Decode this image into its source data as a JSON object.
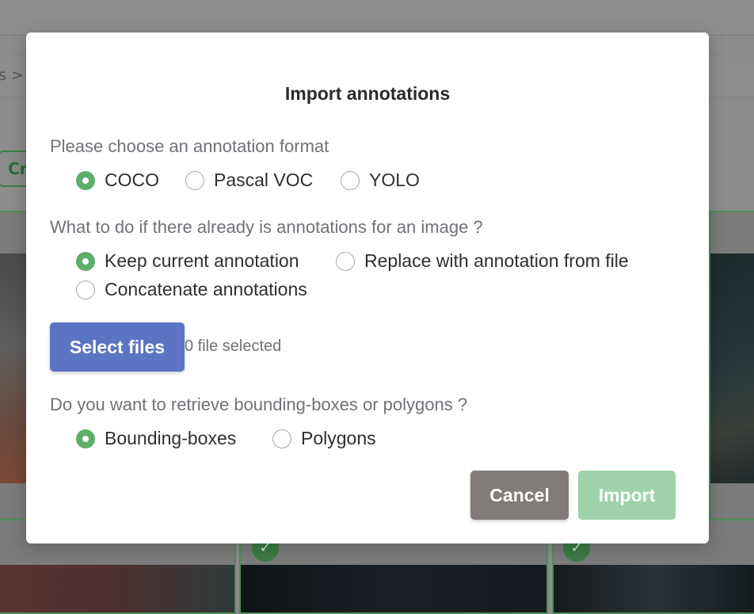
{
  "background": {
    "breadcrumb_text": "s >",
    "create_button_text": "Cr",
    "check_glyph": "✓"
  },
  "modal": {
    "title": "Import annotations",
    "format_section": {
      "question": "Please choose an annotation format",
      "options": [
        {
          "label": "COCO",
          "selected": true
        },
        {
          "label": "Pascal VOC",
          "selected": false
        },
        {
          "label": "YOLO",
          "selected": false
        }
      ]
    },
    "existing_section": {
      "question": "What to do if there already is annotations for an image ?",
      "options": [
        {
          "label": "Keep current annotation",
          "selected": true
        },
        {
          "label": "Replace with annotation from file",
          "selected": false
        },
        {
          "label": "Concatenate annotations",
          "selected": false
        }
      ]
    },
    "files": {
      "button_label": "Select files",
      "status": "0 file selected"
    },
    "shape_section": {
      "question": "Do you want to retrieve bounding-boxes or polygons ?",
      "options": [
        {
          "label": "Bounding-boxes",
          "selected": true
        },
        {
          "label": "Polygons",
          "selected": false
        }
      ]
    },
    "actions": {
      "cancel_label": "Cancel",
      "import_label": "Import"
    }
  },
  "colors": {
    "accent_green": "#5cae6b",
    "primary_blue": "#5b75c4",
    "cancel_gray": "#817b79",
    "import_disabled_green": "#9fd2a9"
  }
}
